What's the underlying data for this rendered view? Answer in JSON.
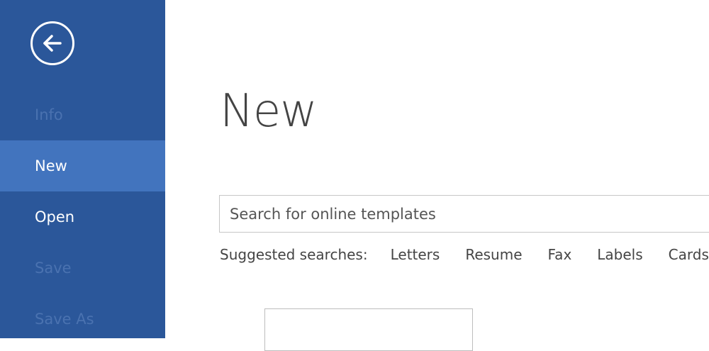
{
  "sidebar": {
    "back_icon": "back-arrow-icon",
    "items": [
      {
        "label": "Info",
        "state": "disabled"
      },
      {
        "label": "New",
        "state": "active"
      },
      {
        "label": "Open",
        "state": "normal"
      },
      {
        "label": "Save",
        "state": "disabled"
      },
      {
        "label": "Save As",
        "state": "disabled"
      }
    ]
  },
  "main": {
    "title": "New",
    "search": {
      "placeholder": "Search for online templates"
    },
    "suggested": {
      "label": "Suggested searches:",
      "links": [
        "Letters",
        "Resume",
        "Fax",
        "Labels",
        "Cards"
      ]
    }
  },
  "colors": {
    "sidebar": "#2b579a",
    "active_item": "#4274be",
    "disabled_text": "#4a72b0"
  }
}
